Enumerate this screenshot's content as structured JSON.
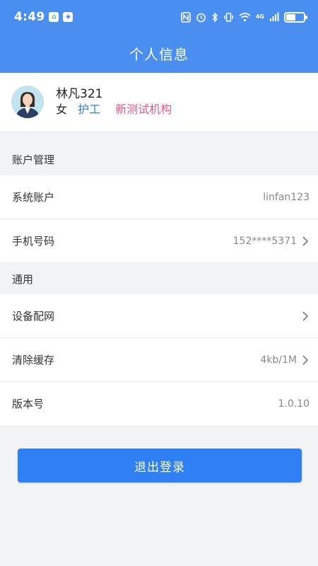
{
  "statusbar": {
    "time": "4:49",
    "network": "4G"
  },
  "header": {
    "title": "个人信息"
  },
  "profile": {
    "name": "林凡321",
    "gender": "女",
    "role": "护工",
    "org": "新测试机构"
  },
  "account": {
    "section_title": "账户管理",
    "rows": [
      {
        "label": "系统账户",
        "value": "linfan123"
      },
      {
        "label": "手机号码",
        "value": "152****5371"
      }
    ]
  },
  "general": {
    "section_title": "通用",
    "rows": [
      {
        "label": "设备配网",
        "value": ""
      },
      {
        "label": "清除缓存",
        "value": "4kb/1M"
      },
      {
        "label": "版本号",
        "value": "1.0.10"
      }
    ]
  },
  "actions": {
    "logout_label": "退出登录"
  },
  "colors": {
    "header_bg": "#4a8ef0",
    "button_bg": "#2f7ff5",
    "role": "#2d7fe8",
    "org": "#e15b86"
  }
}
